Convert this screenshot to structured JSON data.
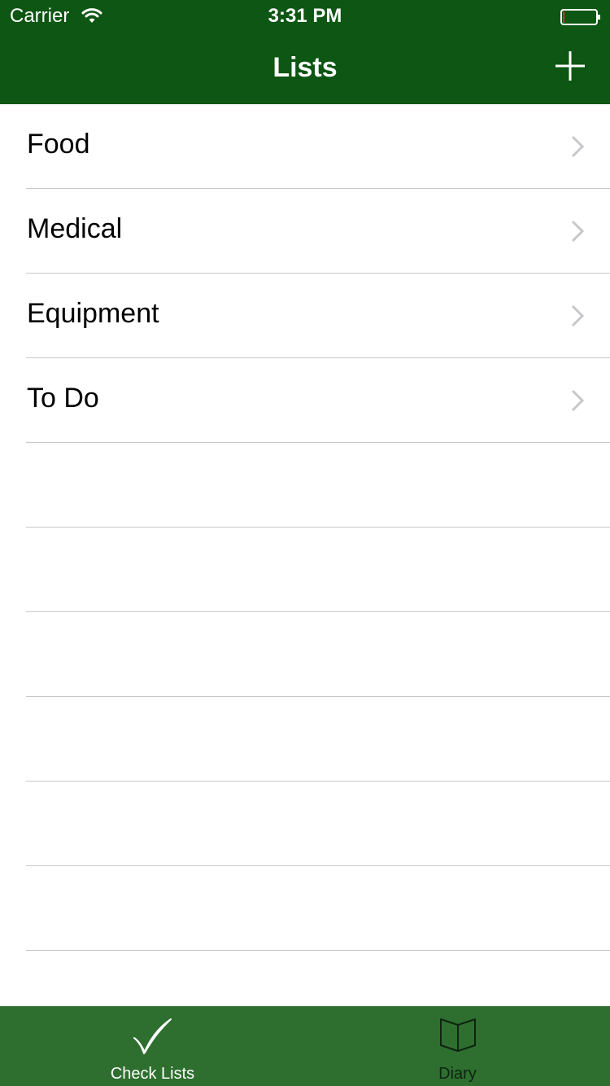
{
  "status_bar": {
    "carrier": "Carrier",
    "time": "3:31 PM"
  },
  "nav": {
    "title": "Lists",
    "add_icon": "plus-icon"
  },
  "lists": {
    "items": [
      {
        "label": "Food"
      },
      {
        "label": "Medical"
      },
      {
        "label": "Equipment"
      },
      {
        "label": "To Do"
      }
    ],
    "empty_rows": 6
  },
  "tab_bar": {
    "tabs": [
      {
        "label": "Check Lists",
        "icon": "checkmark-icon",
        "selected": true
      },
      {
        "label": "Diary",
        "icon": "book-icon",
        "selected": false
      }
    ]
  },
  "colors": {
    "nav_bar": "#0d5613",
    "tab_bar": "#2e6f2f",
    "separator": "#c8c7cc",
    "chevron": "#c7c7cc"
  }
}
